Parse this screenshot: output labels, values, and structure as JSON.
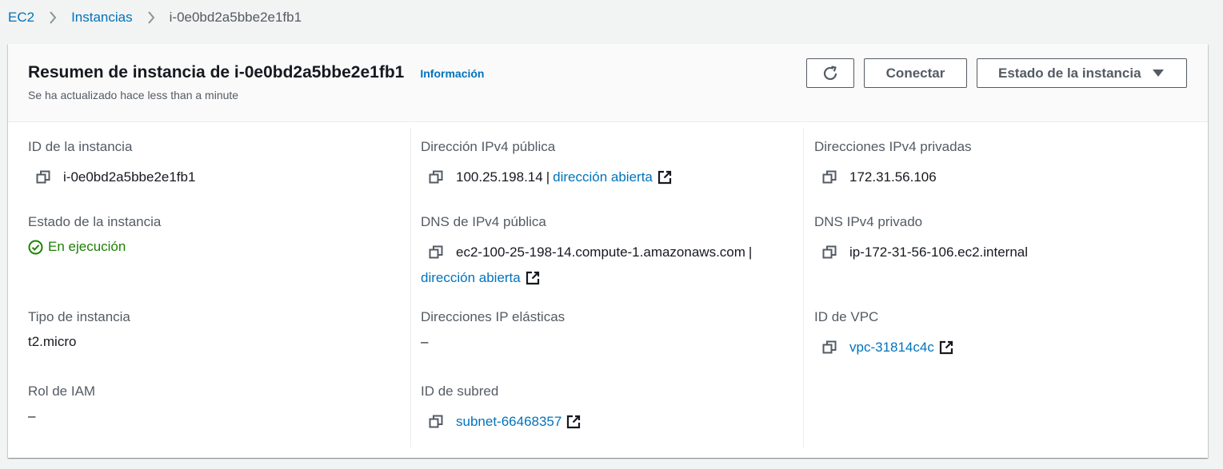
{
  "breadcrumb": {
    "items": [
      {
        "label": "EC2"
      },
      {
        "label": "Instancias"
      },
      {
        "label": "i-0e0bd2a5bbe2e1fb1"
      }
    ]
  },
  "header": {
    "title": "Resumen de instancia de i-0e0bd2a5bbe2e1fb1",
    "info_link": "Información",
    "subtitle": "Se ha actualizado hace less than a minute",
    "connect_label": "Conectar",
    "instance_state_label": "Estado de la instancia"
  },
  "details": {
    "instance_id": {
      "label": "ID de la instancia",
      "value": "i-0e0bd2a5bbe2e1fb1"
    },
    "instance_state": {
      "label": "Estado de la instancia",
      "value": "En ejecución"
    },
    "instance_type": {
      "label": "Tipo de instancia",
      "value": "t2.micro"
    },
    "iam_role": {
      "label": "Rol de IAM",
      "value": "–"
    },
    "public_ipv4": {
      "label": "Dirección IPv4 pública",
      "value": "100.25.198.14",
      "separator": "|",
      "link": "dirección abierta"
    },
    "public_dns": {
      "label": "DNS de IPv4 pública",
      "value": "ec2-100-25-198-14.compute-1.amazonaws.com",
      "separator": "|",
      "link": "dirección abierta"
    },
    "elastic_ips": {
      "label": "Direcciones IP elásticas",
      "value": "–"
    },
    "subnet_id": {
      "label": "ID de subred",
      "value": "subnet-66468357"
    },
    "private_ipv4": {
      "label": "Direcciones IPv4 privadas",
      "value": "172.31.56.106"
    },
    "private_dns": {
      "label": "DNS IPv4 privado",
      "value": "ip-172-31-56-106.ec2.internal"
    },
    "vpc_id": {
      "label": "ID de VPC",
      "value": "vpc-31814c4c"
    }
  },
  "colors": {
    "link": "#0073bb",
    "success": "#1d8102",
    "text": "#16191f",
    "muted": "#545b64"
  }
}
